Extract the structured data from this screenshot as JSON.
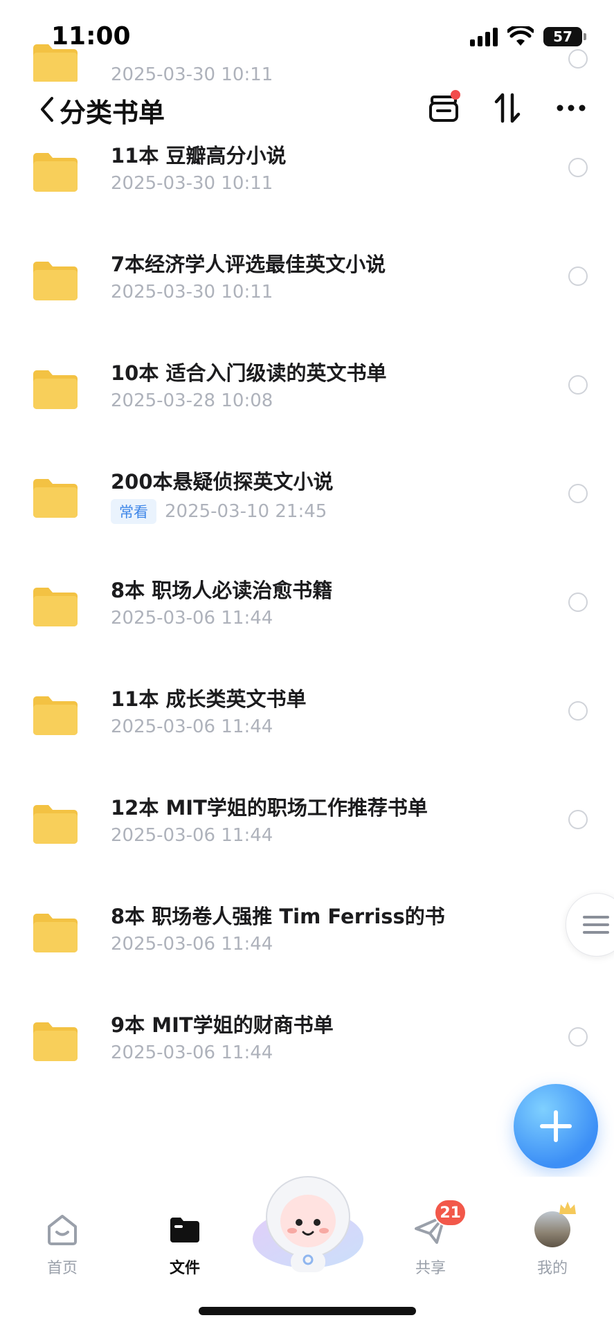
{
  "status_bar": {
    "time": "11:00",
    "battery": "57"
  },
  "header": {
    "title": "分类书单"
  },
  "files": [
    {
      "name": "",
      "date": "2025-03-30 10:11",
      "tag": ""
    },
    {
      "name": "11本 豆瓣高分小说",
      "date": "2025-03-30 10:11",
      "tag": ""
    },
    {
      "name": "7本经济学人评选最佳英文小说",
      "date": "2025-03-30 10:11",
      "tag": ""
    },
    {
      "name": "10本 适合入门级读的英文书单",
      "date": "2025-03-28 10:08",
      "tag": ""
    },
    {
      "name": "200本悬疑侦探英文小说",
      "date": "2025-03-10 21:45",
      "tag": "常看"
    },
    {
      "name": "8本 职场人必读治愈书籍",
      "date": "2025-03-06 11:44",
      "tag": ""
    },
    {
      "name": "11本 成长类英文书单",
      "date": "2025-03-06 11:44",
      "tag": ""
    },
    {
      "name": "12本 MIT学姐的职场工作推荐书单",
      "date": "2025-03-06 11:44",
      "tag": ""
    },
    {
      "name": "8本 职场卷人强推 Tim Ferriss的书",
      "date": "2025-03-06 11:44",
      "tag": ""
    },
    {
      "name": "9本 MIT学姐的财商书单",
      "date": "2025-03-06 11:44",
      "tag": ""
    }
  ],
  "tab_bar": {
    "home": "首页",
    "files": "文件",
    "share": "共享",
    "share_badge": "21",
    "me": "我的"
  },
  "colors": {
    "accent": "#3c8ff6",
    "folder": "#f8cf5a",
    "badge": "#f2584a"
  }
}
